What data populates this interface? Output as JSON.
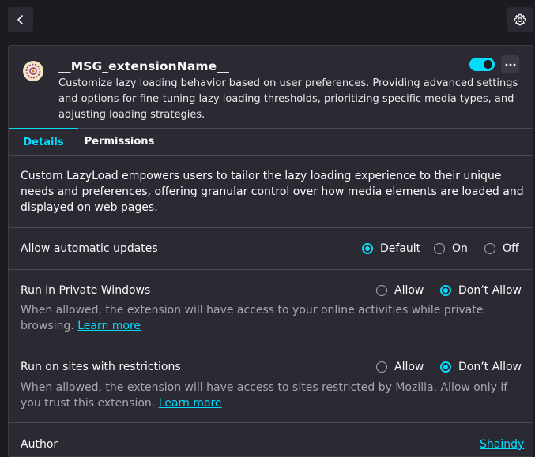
{
  "icons": {
    "back": "chevron-left-icon",
    "settings": "gear-icon",
    "extension": "extension-logo-icon",
    "more": "more-options-icon"
  },
  "colors": {
    "accent": "#00ddff",
    "background": "#1c1b22",
    "card": "#2b2a33",
    "muted_text": "#a8a7ae"
  },
  "extension": {
    "name": "__MSG_extensionName__",
    "description": "Customize lazy loading behavior based on user preferences. Providing advanced settings and options for fine-tuning lazy loading thresholds, prioritizing specific media types, and adjusting loading strategies.",
    "enabled": true
  },
  "tabs": [
    {
      "label": "Details",
      "active": true
    },
    {
      "label": "Permissions",
      "active": false
    }
  ],
  "overview": "Custom LazyLoad empowers users to tailor the lazy loading experience to their unique needs and preferences, offering granular control over how media elements are loaded and displayed on web pages.",
  "updates": {
    "label": "Allow automatic updates",
    "options": [
      "Default",
      "On",
      "Off"
    ],
    "selected": "Default"
  },
  "private_windows": {
    "label": "Run in Private Windows",
    "options": [
      "Allow",
      "Don’t Allow"
    ],
    "selected": "Don’t Allow",
    "description": "When allowed, the extension will have access to your online activities while private browsing.",
    "link": "Learn more"
  },
  "restricted_sites": {
    "label": "Run on sites with restrictions",
    "options": [
      "Allow",
      "Don’t Allow"
    ],
    "selected": "Don’t Allow",
    "description": "When allowed, the extension will have access to sites restricted by Mozilla. Allow only if you trust this extension.",
    "link": "Learn more"
  },
  "author": {
    "label": "Author",
    "value": "Shaindy"
  }
}
